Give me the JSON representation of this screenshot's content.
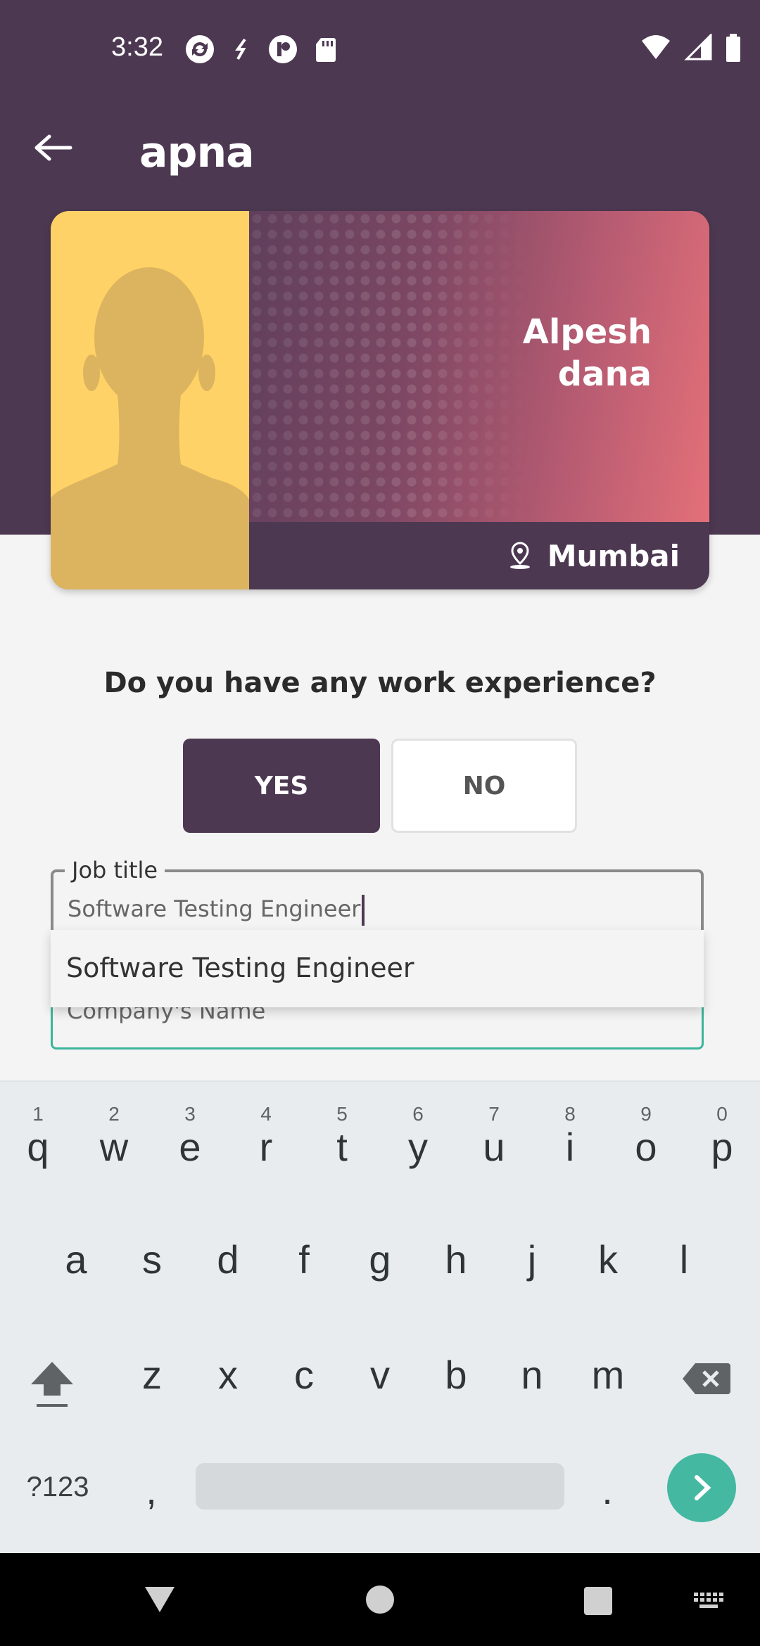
{
  "status_bar": {
    "time": "3:32"
  },
  "toolbar": {
    "title": "apna"
  },
  "profile_card": {
    "name": "Alpesh dana",
    "city": "Mumbai"
  },
  "question": "Do you have any work experience?",
  "answer_buttons": {
    "yes": "YES",
    "no": "NO"
  },
  "job_title_field": {
    "label": "Job title",
    "value": "Software Testing Engineer"
  },
  "company_field": {
    "placeholder": "Company's Name"
  },
  "autocomplete": {
    "suggestion": "Software Testing Engineer"
  },
  "keyboard": {
    "row1": [
      "q",
      "w",
      "e",
      "r",
      "t",
      "y",
      "u",
      "i",
      "o",
      "p"
    ],
    "row1_hints": [
      "1",
      "2",
      "3",
      "4",
      "5",
      "6",
      "7",
      "8",
      "9",
      "0"
    ],
    "row2": [
      "a",
      "s",
      "d",
      "f",
      "g",
      "h",
      "j",
      "k",
      "l"
    ],
    "row3": [
      "z",
      "x",
      "c",
      "v",
      "b",
      "n",
      "m"
    ],
    "symbols_key": "?123",
    "comma_key": ",",
    "period_key": "."
  },
  "colors": {
    "primary": "#4d3852",
    "accent_green": "#3bb59b",
    "card_yellow": "#fed266"
  }
}
